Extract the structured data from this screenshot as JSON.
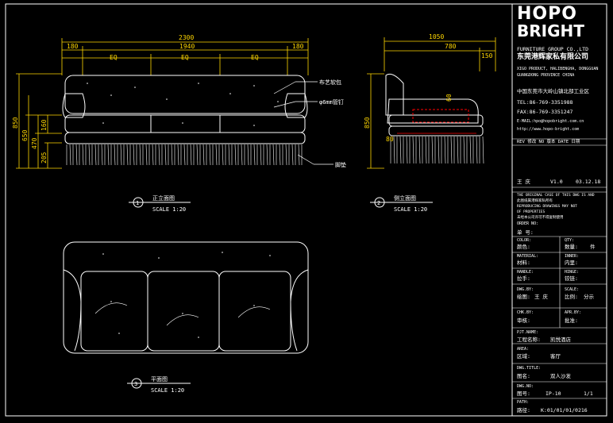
{
  "drawing": {
    "front_view": {
      "dims": {
        "total": "2300",
        "arm_l": "180",
        "seat": "1940",
        "arm_r": "180",
        "eq1": "EQ",
        "eq2": "EQ",
        "eq3": "EQ"
      },
      "heights": {
        "h850": "850",
        "h650": "650",
        "h470": "470",
        "h205": "205",
        "h160": "160"
      },
      "callouts": {
        "fabric": "布艺软包",
        "pipe": "φ6mm管钉",
        "base": "脚垫"
      },
      "title": "正立面图",
      "scale": "SCALE 1:20",
      "number": "1"
    },
    "side_view": {
      "dims": {
        "depth": "1050",
        "seat_depth": "780",
        "arm": "150",
        "height": "850",
        "d60": "60",
        "d80": "80"
      },
      "title": "侧立面图",
      "scale": "SCALE 1:20",
      "number": "2"
    },
    "plan_view": {
      "title": "平面图",
      "scale": "SCALE 1:20",
      "number": "3"
    }
  },
  "title_block": {
    "logo_line1": "HOPO",
    "logo_line2": "BRIGHT",
    "company_en": "FURNITURE GROUP CO.,LTD",
    "company_cn": "东莞港辉家私有限公司",
    "addr1": "XIGO PRODUCT, HALIBENGHA, DONGGUAN",
    "addr2": "GUANGDONG PROVINCE CHINA",
    "addr_cn": "中国东莞市大岭山镇北部工业区",
    "tel": "TEL:86-769-3351988",
    "fax": "FAX:86-769-3351247",
    "email": "E-MAIL:hpo@hopobright.com.cn",
    "web": "http://www.hopo-bright.com",
    "rev_header": "REV 修改   NO 版本    DATE 日期",
    "rev_name": "王 庆",
    "rev_no": "V1.0",
    "rev_date": "03.12.18",
    "notice1": "THE ORIGINAL CASE OF THIS DWG IS AND",
    "notice2": "此图纸属港辉家私所有",
    "notice3": "REPRODUCING DRAWINGS MAY NOT",
    "notice4": "OF PROPERTIES",
    "notice5": "未经本公司许可不得复制使用",
    "order_label": "ORDER NO:",
    "order_cn": "单 号:",
    "color_label": "COLOR:",
    "color_cn": "颜色:",
    "qty_label": "QTY:",
    "qty_cn": "数量:",
    "qty_unit": "件",
    "material_label": "MATERIAL:",
    "material_cn": "材料:",
    "inner_label": "INNER:",
    "inner_cn": "内里:",
    "handle_label": "HANDLE:",
    "handle_cn": "拉手:",
    "hinge_label": "HINGE:",
    "hinge_cn": "铰链:",
    "dwg_label": "DWG.BY:",
    "dwg_cn": "绘图:",
    "dwg_name": "王 庆",
    "scale_label": "SCALE:",
    "scale_cn": "比例:",
    "scale_value": "分示",
    "chk_label": "CHK.BY:",
    "chk_cn": "审核:",
    "apr_label": "APR.BY:",
    "apr_cn": "批准:",
    "pjt_label": "PJT.NAME:",
    "pjt_cn": "工程名称:",
    "pjt_value": "凯悦酒店",
    "area_label": "AREA:",
    "area_cn": "区域:",
    "area_value": "客厅",
    "dwg_title_label": "DWG.TITLE:",
    "dwg_title_cn": "图名:",
    "dwg_title_value": "双人沙发",
    "dwg_no_label": "DWG.NO:",
    "dwg_no_cn": "图号:",
    "dwg_no_value": "IP-10",
    "sheet": "1/1",
    "path_label": "PATH:",
    "path_cn": "路径:",
    "path_value": "K:01/01/01/0216"
  }
}
